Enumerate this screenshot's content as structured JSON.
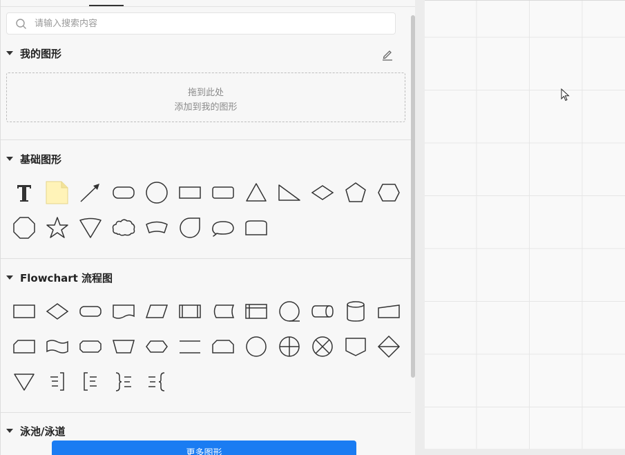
{
  "search": {
    "placeholder": "请输入搜索内容"
  },
  "sections": {
    "my_shapes": {
      "title": "我的图形",
      "drop_zone": {
        "line1": "拖到此处",
        "line2": "添加到我的图形"
      }
    },
    "basic": {
      "title": "基础图形",
      "shapes": [
        "text",
        "note",
        "arrow",
        "rounded-rect",
        "circle",
        "rectangle",
        "rounded-rectangle",
        "triangle",
        "right-triangle",
        "diamond",
        "pentagon",
        "hexagon",
        "octagon",
        "star",
        "inverted-triangle-rounded",
        "cloud",
        "fan",
        "teardrop",
        "speech-bubble",
        "curved-rectangle"
      ]
    },
    "flowchart": {
      "title": "Flowchart 流程图",
      "shapes": [
        "process",
        "decision",
        "terminator",
        "document",
        "data",
        "predefined-process",
        "stored-data",
        "internal-storage",
        "sequential-data",
        "direct-data",
        "database",
        "manual-input",
        "card",
        "tape",
        "preparation",
        "manual-operation",
        "display",
        "parallel-mode",
        "loop-limit",
        "connector",
        "or",
        "summing-junction",
        "offpage-reference",
        "sort",
        "merge",
        "annotation-right",
        "annotation-left",
        "brace-left",
        "brace-right"
      ]
    },
    "swimlane": {
      "title": "泳池/泳道"
    }
  },
  "more_button": {
    "label": "更多图形"
  },
  "colors": {
    "accent": "#1a7cf2",
    "shape_stroke": "#333333",
    "note_fill": "#fff3b8"
  }
}
